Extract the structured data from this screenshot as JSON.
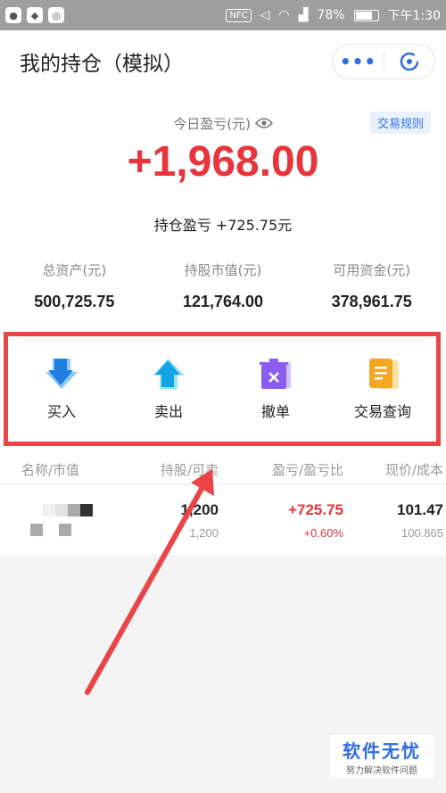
{
  "status_bar": {
    "nfc": "NFC",
    "battery": "78%",
    "time": "下午1:30",
    "battery_level": 0.78
  },
  "header": {
    "title": "我的持仓（模拟）",
    "more_icon": "more-dots-icon",
    "close_icon": "close-circle-icon"
  },
  "rules_tag": "交易规则",
  "today": {
    "label": "今日盈亏(元)",
    "value": "+1,968.00",
    "eye_icon": "eye-icon"
  },
  "hold_pl": "持仓盈亏 +725.75元",
  "stats": [
    {
      "label": "总资产(元)",
      "value": "500,725.75"
    },
    {
      "label": "持股市值(元)",
      "value": "121,764.00"
    },
    {
      "label": "可用资金(元)",
      "value": "378,961.75"
    }
  ],
  "actions": [
    {
      "label": "买入",
      "icon": "buy-arrow-down-icon",
      "color": "#2f8be8"
    },
    {
      "label": "卖出",
      "icon": "sell-arrow-up-icon",
      "color": "#1fa3e8"
    },
    {
      "label": "撤单",
      "icon": "cancel-order-icon",
      "color": "#8a5cf0"
    },
    {
      "label": "交易查询",
      "icon": "trade-query-icon",
      "color": "#f5a623"
    }
  ],
  "table": {
    "headers": [
      "名称/市值",
      "持股/可卖",
      "盈亏/盈亏比",
      "现价/成本"
    ],
    "rows": [
      {
        "shares": "1,200",
        "sellable": "1,200",
        "pl": "+725.75",
        "pl_ratio": "+0.60%",
        "price": "101.47",
        "cost": "100.865"
      }
    ]
  },
  "watermark": {
    "title": "软件无忧",
    "subtitle": "努力解决软件问题"
  },
  "colors": {
    "accent": "#2f6ee0",
    "profit": "#e8343d",
    "highlight_box": "#e94447"
  }
}
